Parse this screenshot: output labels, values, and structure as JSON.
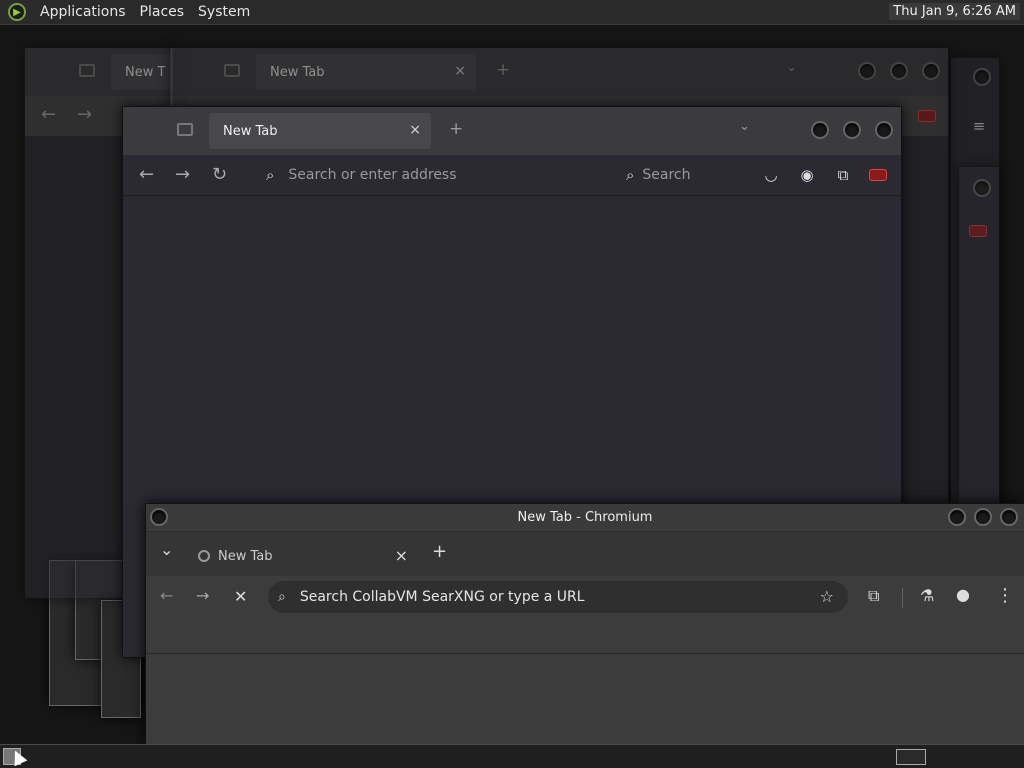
{
  "top_panel": {
    "menus": [
      "Applications",
      "Places",
      "System"
    ],
    "clock": "Thu Jan  9,  6:26 AM"
  },
  "firefox_back1": {
    "tab_label": "New T"
  },
  "firefox_back2": {
    "tab_label": "New Tab"
  },
  "firefox_front": {
    "tab_label": "New Tab",
    "url_placeholder": "Search or enter address",
    "search_placeholder": "Search"
  },
  "chromium": {
    "window_title": "New Tab - Chromium",
    "tab_label": "New Tab",
    "omnibox_placeholder": "Search CollabVM SearXNG or type a URL"
  },
  "icons": {
    "close": "×",
    "plus": "+",
    "back": "←",
    "forward": "→",
    "reload": "↻",
    "stop": "✕",
    "search": "⌕",
    "star": "☆",
    "menu": "⋮",
    "chevron": "⌄"
  }
}
